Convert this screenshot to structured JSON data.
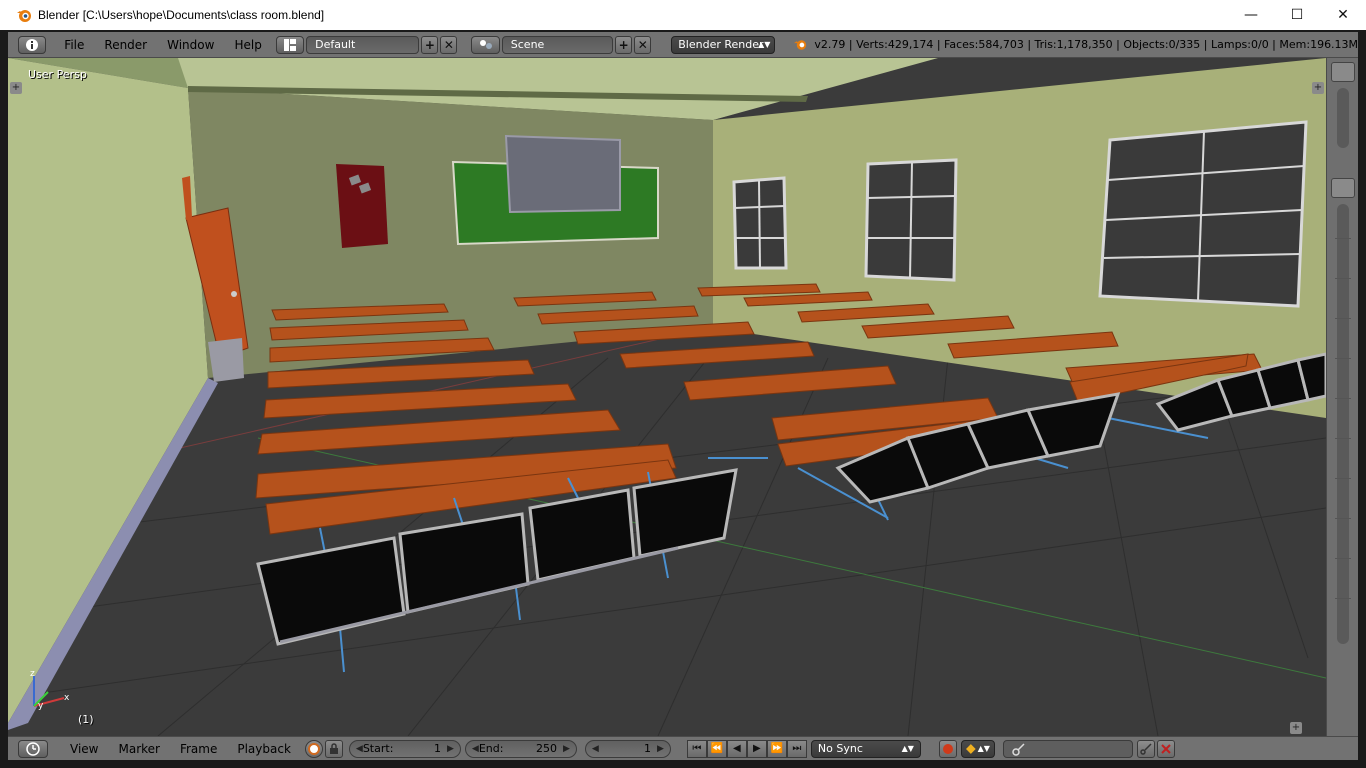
{
  "window": {
    "title": "Blender [C:\\Users\\hope\\Documents\\class room.blend]",
    "minimize_glyph": "—",
    "maximize_glyph": "☐",
    "close_glyph": "✕"
  },
  "top_header": {
    "menus": [
      "File",
      "Render",
      "Window",
      "Help"
    ],
    "layout_name": "Default",
    "scene_name": "Scene",
    "render_engine": "Blender Render",
    "stats": "v2.79 | Verts:429,174 | Faces:584,703 | Tris:1,178,350 | Objects:0/335 | Lamps:0/0 | Mem:196.13M"
  },
  "viewport": {
    "view_label": "User Persp",
    "frame_indicator": "(1)"
  },
  "timeline": {
    "menus": [
      "View",
      "Marker",
      "Frame",
      "Playback"
    ],
    "start_label": "Start:",
    "start_value": "1",
    "end_label": "End:",
    "end_value": "250",
    "current_frame": "1",
    "sync_mode": "No Sync"
  },
  "colors": {
    "header_bg": "#727272",
    "viewport_floor": "#3b3b3b",
    "left_wall": "#b3c08a",
    "back_wall": "#7f8762",
    "right_wall": "#a8b079",
    "desk": "#b5521c",
    "chalkboard": "#2d7a24",
    "door": "#c0501e",
    "legs": "#4a90d0",
    "chair": "#0a0a0a"
  },
  "icons": {
    "app_logo": "blender-logo-icon",
    "info": "info-icon",
    "layout": "layout-grid-icon",
    "scene": "scene-icon",
    "render_engine": "render-icon",
    "timeline_view": "clock-icon",
    "record": "record-icon",
    "keyframe": "keyframe-icon"
  }
}
